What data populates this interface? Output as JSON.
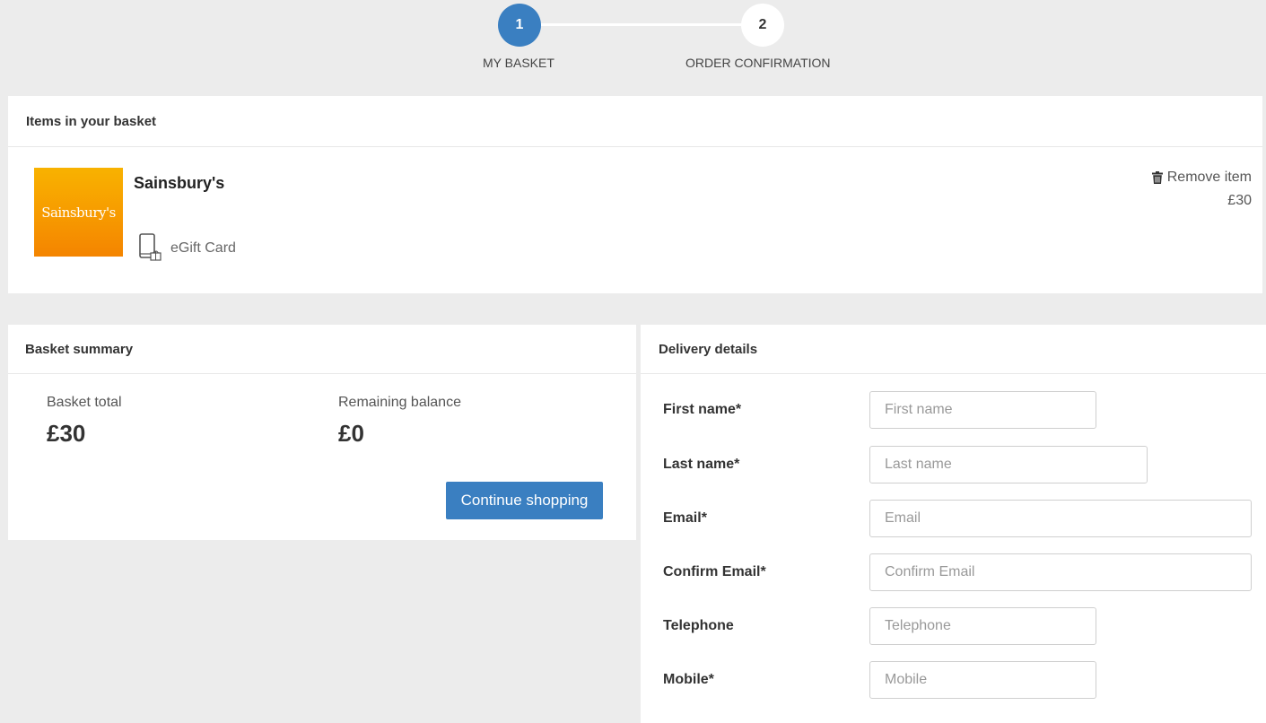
{
  "stepper": {
    "steps": [
      {
        "number": "1",
        "label": "MY BASKET",
        "active": true
      },
      {
        "number": "2",
        "label": "ORDER CONFIRMATION",
        "active": false
      }
    ]
  },
  "basket": {
    "header": "Items in your basket",
    "item": {
      "logo_text": "Sainsbury's",
      "name": "Sainsbury's",
      "type_icon": "mobile-gift-icon",
      "type": "eGift Card",
      "remove_icon": "trash-icon",
      "remove_label": "Remove item",
      "price": "£30"
    }
  },
  "summary": {
    "header": "Basket summary",
    "total_label": "Basket total",
    "total_value": "£30",
    "balance_label": "Remaining balance",
    "balance_value": "£0",
    "continue_label": "Continue shopping"
  },
  "delivery": {
    "header": "Delivery details",
    "fields": [
      {
        "label": "First name*",
        "placeholder": "First name",
        "value": ""
      },
      {
        "label": "Last name*",
        "placeholder": "Last name",
        "value": ""
      },
      {
        "label": "Email*",
        "placeholder": "Email",
        "value": ""
      },
      {
        "label": "Confirm Email*",
        "placeholder": "Confirm Email",
        "value": ""
      },
      {
        "label": "Telephone",
        "placeholder": "Telephone",
        "value": ""
      },
      {
        "label": "Mobile*",
        "placeholder": "Mobile",
        "value": ""
      }
    ]
  },
  "colors": {
    "accent": "#3a7fc1",
    "background": "#ececec",
    "panel": "#ffffff",
    "brand_orange": "#f79a00"
  }
}
